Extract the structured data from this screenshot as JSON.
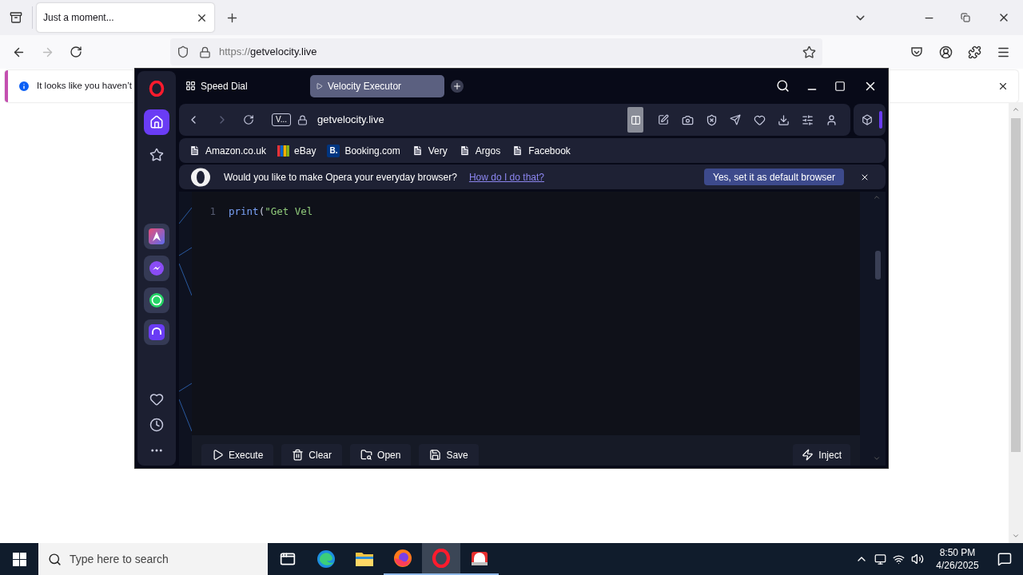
{
  "firefox": {
    "tab": {
      "title": "Just a moment..."
    },
    "url": {
      "scheme": "https://",
      "host": "getvelocity.live"
    },
    "notification": "It looks like you haven’t"
  },
  "opera": {
    "tabs": [
      {
        "label": "Speed Dial",
        "kind": "speed-dial",
        "selected": false
      },
      {
        "label": "Velocity Executor",
        "kind": "page",
        "selected": true
      }
    ],
    "sidebar": [
      {
        "kind": "home",
        "selected": true
      },
      {
        "kind": "star",
        "selected": false
      },
      {
        "kind": "aria",
        "selected": false
      },
      {
        "kind": "messenger",
        "selected": false
      },
      {
        "kind": "whatsapp",
        "selected": false
      },
      {
        "kind": "music",
        "selected": false
      }
    ],
    "address": {
      "badge": "V...",
      "url": "getvelocity.live"
    },
    "bookmarks": [
      {
        "label": "Amazon.co.uk",
        "kind": "page"
      },
      {
        "label": "eBay",
        "kind": "bars"
      },
      {
        "label": "Booking.com",
        "kind": "letter",
        "icon_text": "B."
      },
      {
        "label": "Very",
        "kind": "page"
      },
      {
        "label": "Argos",
        "kind": "page"
      },
      {
        "label": "Facebook",
        "kind": "page"
      }
    ],
    "prompt": {
      "message": "Would you like to make Opera your everyday browser?",
      "link": "How do I do that?",
      "button": "Yes, set it as default browser"
    },
    "editor": {
      "lines": [
        {
          "number": "1",
          "tokens": [
            {
              "text": "print",
              "kind": "function"
            },
            {
              "text": "(",
              "kind": "punct"
            },
            {
              "text": "\"Get Vel",
              "kind": "string"
            }
          ]
        }
      ]
    },
    "actions": [
      {
        "label": "Execute",
        "kind": "play"
      },
      {
        "label": "Clear",
        "kind": "trash"
      },
      {
        "label": "Open",
        "kind": "folder"
      },
      {
        "label": "Save",
        "kind": "save"
      }
    ],
    "inject": {
      "label": "Inject"
    }
  },
  "taskbar": {
    "search_placeholder": "Type here to search",
    "apps": [
      {
        "kind": "taskview",
        "running": false,
        "selected": false
      },
      {
        "kind": "edge",
        "running": false,
        "selected": false
      },
      {
        "kind": "explorer",
        "running": false,
        "selected": false
      },
      {
        "kind": "firefox",
        "running": true,
        "selected": false
      },
      {
        "kind": "opera",
        "running": true,
        "selected": true
      },
      {
        "kind": "app",
        "running": true,
        "selected": false
      }
    ],
    "time": "8:50 PM",
    "date": "4/26/2025"
  }
}
